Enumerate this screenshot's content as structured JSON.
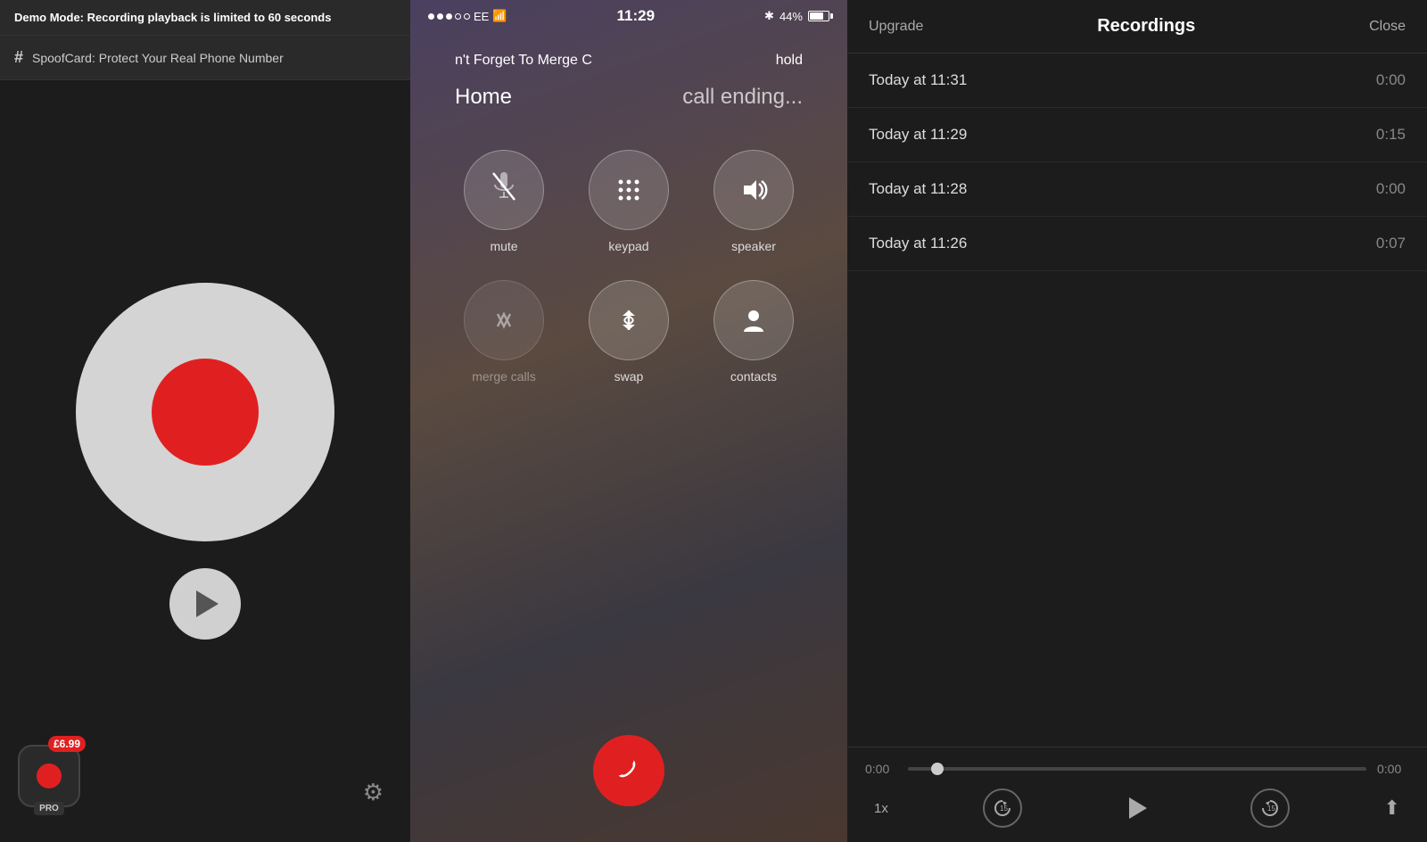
{
  "left": {
    "demo_banner": "Demo Mode: Recording playback is limited to 60 seconds",
    "demo_bold": "Demo Mode:",
    "spoofcard_label": "SpoofCard: Protect Your Real Phone Number",
    "pro_price": "£6.99",
    "pro_label": "PRO"
  },
  "phone": {
    "carrier": "EE",
    "time": "11:29",
    "battery": "44%",
    "call_top": "n't Forget To Merge C",
    "call_hold": "hold",
    "call_home": "Home",
    "call_ending": "call ending...",
    "buttons": [
      {
        "id": "mute",
        "label": "mute",
        "icon": "🎤"
      },
      {
        "id": "keypad",
        "label": "keypad",
        "icon": "⠿"
      },
      {
        "id": "speaker",
        "label": "speaker",
        "icon": "🔊"
      },
      {
        "id": "merge",
        "label": "merge calls",
        "icon": "⇈"
      },
      {
        "id": "swap",
        "label": "swap",
        "icon": "⇅"
      },
      {
        "id": "contacts",
        "label": "contacts",
        "icon": "👤"
      }
    ]
  },
  "recordings": {
    "title": "Recordings",
    "upgrade_label": "Upgrade",
    "close_label": "Close",
    "items": [
      {
        "timestamp": "Today at 11:31",
        "duration": "0:00"
      },
      {
        "timestamp": "Today at 11:29",
        "duration": "0:15"
      },
      {
        "timestamp": "Today at 11:28",
        "duration": "0:00"
      },
      {
        "timestamp": "Today at 11:26",
        "duration": "0:07"
      }
    ],
    "playback": {
      "current_time": "0:00",
      "end_time": "0:00",
      "speed": "1x"
    }
  }
}
